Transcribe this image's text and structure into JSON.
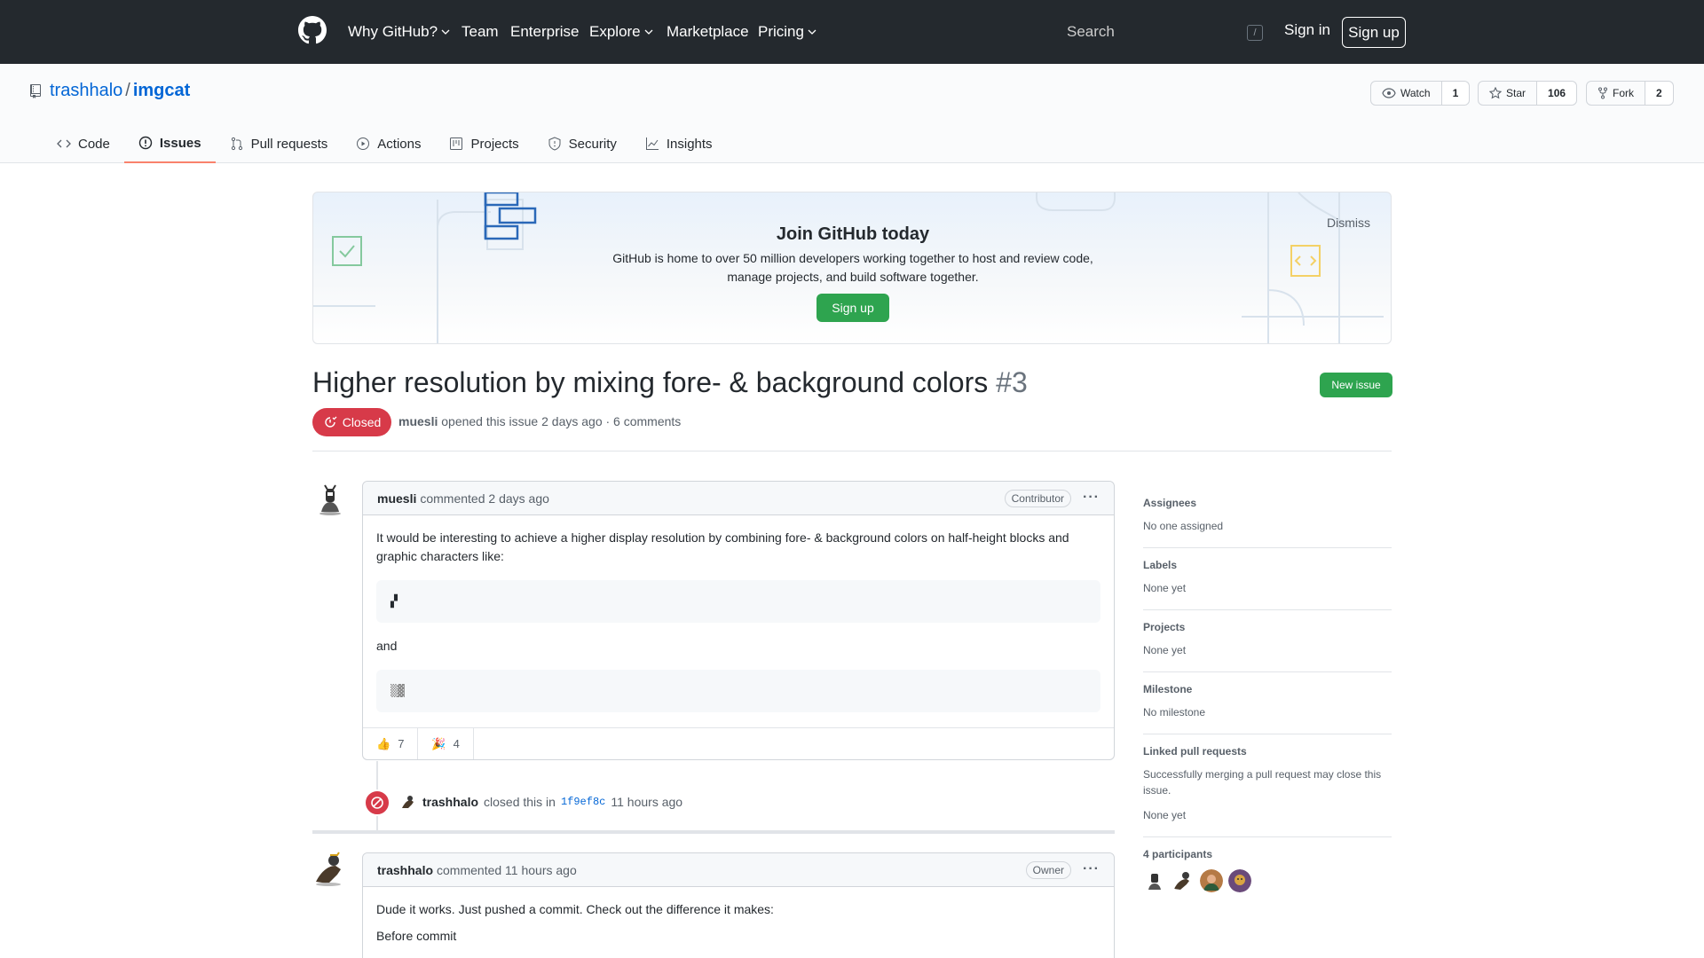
{
  "header": {
    "nav": [
      {
        "label": "Why GitHub?",
        "dropdown": true
      },
      {
        "label": "Team",
        "dropdown": false
      },
      {
        "label": "Enterprise",
        "dropdown": false
      },
      {
        "label": "Explore",
        "dropdown": true
      },
      {
        "label": "Marketplace",
        "dropdown": false
      },
      {
        "label": "Pricing",
        "dropdown": true
      }
    ],
    "search_placeholder": "Search",
    "search_shortcut": "/",
    "sign_in": "Sign in",
    "sign_up": "Sign up"
  },
  "repo": {
    "owner": "trashhalo",
    "separator": "/",
    "name": "imgcat",
    "watch_label": "Watch",
    "watch_count": "1",
    "star_label": "Star",
    "star_count": "106",
    "fork_label": "Fork",
    "fork_count": "2",
    "tabs": [
      {
        "label": "Code",
        "icon": "code-icon",
        "selected": false
      },
      {
        "label": "Issues",
        "icon": "issue-opened-icon",
        "selected": true
      },
      {
        "label": "Pull requests",
        "icon": "git-pull-request-icon",
        "selected": false
      },
      {
        "label": "Actions",
        "icon": "play-icon",
        "selected": false
      },
      {
        "label": "Projects",
        "icon": "project-icon",
        "selected": false
      },
      {
        "label": "Security",
        "icon": "shield-icon",
        "selected": false
      },
      {
        "label": "Insights",
        "icon": "graph-icon",
        "selected": false
      }
    ]
  },
  "banner": {
    "title": "Join GitHub today",
    "text_line1": "GitHub is home to over 50 million developers working together to host and review code,",
    "text_line2": "manage projects, and build software together.",
    "sign_up": "Sign up",
    "dismiss": "Dismiss"
  },
  "issue": {
    "title": "Higher resolution by mixing fore- & background colors",
    "number": "#3",
    "new_issue": "New issue",
    "state": "Closed",
    "author": "muesli",
    "meta_text": "opened this issue 2 days ago · 6 comments"
  },
  "comments": [
    {
      "author": "muesli",
      "action": "commented 2 days ago",
      "role": "Contributor",
      "body_line1": "It would be interesting to achieve a higher display resolution by combining fore- & background colors on half-height blocks and",
      "body_line2": "graphic characters like:",
      "code1": "▞",
      "between": "and",
      "code2": "▒▓",
      "reactions": [
        {
          "emoji": "👍",
          "count": "7"
        },
        {
          "emoji": "🎉",
          "count": "4"
        }
      ]
    },
    {
      "author": "trashhalo",
      "action": "commented 11 hours ago",
      "role": "Owner",
      "body_line1": "Dude it works. Just pushed a commit. Check out the difference it makes:",
      "body_line2": "Before commit"
    }
  ],
  "event": {
    "actor": "trashhalo",
    "text": "closed this in",
    "sha": "1f9ef8c",
    "time": "11 hours ago"
  },
  "sidebar": {
    "assignees": {
      "title": "Assignees",
      "value": "No one assigned"
    },
    "labels": {
      "title": "Labels",
      "value": "None yet"
    },
    "projects": {
      "title": "Projects",
      "value": "None yet"
    },
    "milestone": {
      "title": "Milestone",
      "value": "No milestone"
    },
    "linked": {
      "title": "Linked pull requests",
      "desc": "Successfully merging a pull request may close this issue.",
      "value": "None yet"
    },
    "participants": {
      "title": "4 participants"
    }
  },
  "colors": {
    "header_bg": "#24292e",
    "link": "#0366d6",
    "green": "#2ea44f",
    "closed_red": "#d73a49",
    "tab_underline": "#f9826c"
  }
}
